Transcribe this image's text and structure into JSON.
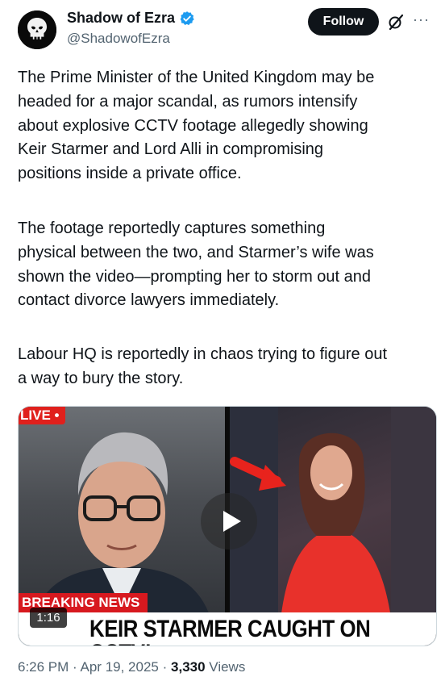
{
  "author": {
    "display_name": "Shadow of Ezra",
    "handle": "@ShadowofEzra",
    "verified": true,
    "verified_color": "#1d9bf0"
  },
  "actions": {
    "follow_label": "Follow",
    "grok_icon": "grok-icon",
    "more_icon": "more-icon",
    "more_glyph": "···"
  },
  "tweet": {
    "paragraphs": [
      "The Prime Minister of the United Kingdom may be\nheaded for a major scandal, as rumors intensify\nabout explosive CCTV footage allegedly showing\nKeir Starmer and Lord Alli in compromising\npositions inside a private office.",
      "The footage reportedly captures something\nphysical between the two, and Starmer’s wife was\nshown the video—prompting her to storm out and\ncontact divorce lawyers immediately.",
      "Labour HQ is reportedly in chaos trying to figure out\na way to bury the story."
    ]
  },
  "media": {
    "live_badge": "LIVE •",
    "breaking_label": "BREAKING NEWS",
    "caption": "KEIR STARMER CAUGHT ON CCTV!",
    "duration": "1:16",
    "play_icon": "play-icon",
    "accent_red": "#d7191f"
  },
  "meta": {
    "time": "6:26 PM",
    "separator": "·",
    "date": "Apr 19, 2025",
    "views_count": "3,330",
    "views_label": "Views"
  }
}
